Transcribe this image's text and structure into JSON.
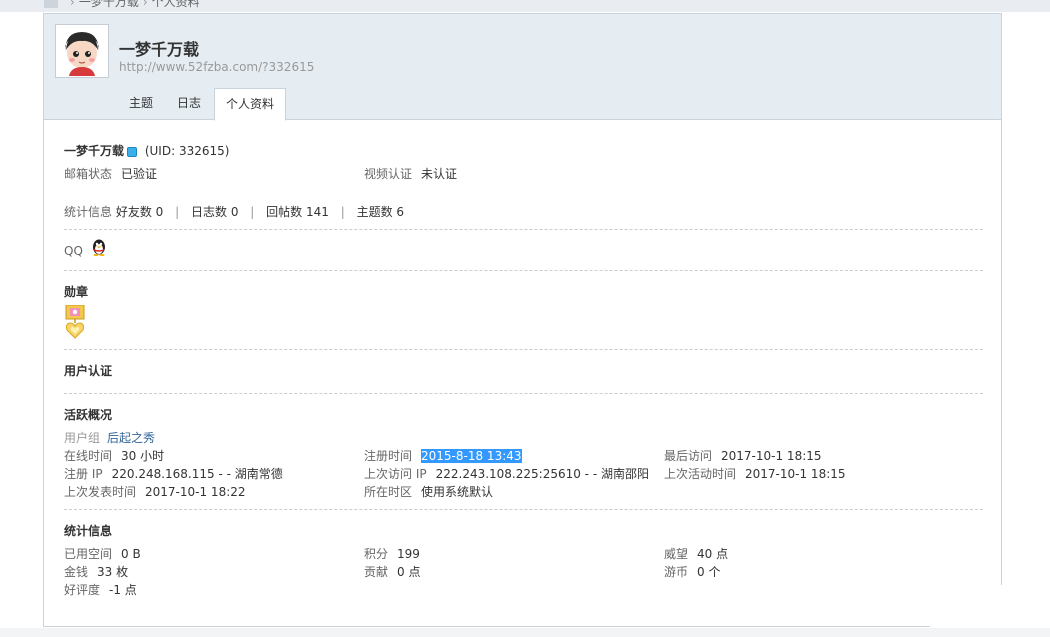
{
  "breadcrumb": {
    "parent": "一梦千万载",
    "current": "个人资料"
  },
  "header": {
    "username": "一梦千万载",
    "space_url": "http://www.52fzba.com/?332615"
  },
  "tabs": {
    "topics": "主题",
    "blog": "日志",
    "profile": "个人资料"
  },
  "identity": {
    "name": "一梦千万载",
    "uid": "(UID: 332615)"
  },
  "email": {
    "label": "邮箱状态",
    "value": "已验证"
  },
  "video": {
    "label": "视频认证",
    "value": "未认证"
  },
  "stats_line": {
    "label": "统计信息",
    "friends": "好友数 0",
    "blogs": "日志数 0",
    "replies": "回帖数 141",
    "topics": "主题数 6",
    "pipe": "|"
  },
  "qq": {
    "label": "QQ",
    "icon": "qq-penguin-icon"
  },
  "medals": {
    "title": "勋章",
    "icon": "medal-icon"
  },
  "verification": {
    "title": "用户认证"
  },
  "activity": {
    "title": "活跃概况",
    "group_label": "用户组",
    "group_value": "后起之秀",
    "online_label": "在线时间",
    "online_value": "30 小时",
    "reg_time_label": "注册时间",
    "reg_time_value": "2015-8-18 13:43",
    "last_visit_label": "最后访问",
    "last_visit_value": "2017-10-1 18:15",
    "reg_ip_label": "注册 IP",
    "reg_ip_value": "220.248.168.115 - - 湖南常德",
    "last_ip_label": "上次访问 IP",
    "last_ip_value": "222.243.108.225:25610 - - 湖南邵阳",
    "last_active_label": "上次活动时间",
    "last_active_value": "2017-10-1 18:15",
    "last_post_label": "上次发表时间",
    "last_post_value": "2017-10-1 18:22",
    "timezone_label": "所在时区",
    "timezone_value": "使用系统默认"
  },
  "statistics": {
    "title": "统计信息",
    "space_label": "已用空间",
    "space_value": "0 B",
    "points_label": "积分",
    "points_value": "199",
    "prestige_label": "威望",
    "prestige_value": "40 点",
    "money_label": "金钱",
    "money_value": "33 枚",
    "contribution_label": "贡献",
    "contribution_value": "0 点",
    "coins_label": "游币",
    "coins_value": "0 个",
    "rating_label": "好评度",
    "rating_value": "-1 点"
  },
  "colors": {
    "header_bg": "#e5edf3",
    "border": "#c9d3dc",
    "link": "#336699",
    "highlight": "#3399ff"
  }
}
